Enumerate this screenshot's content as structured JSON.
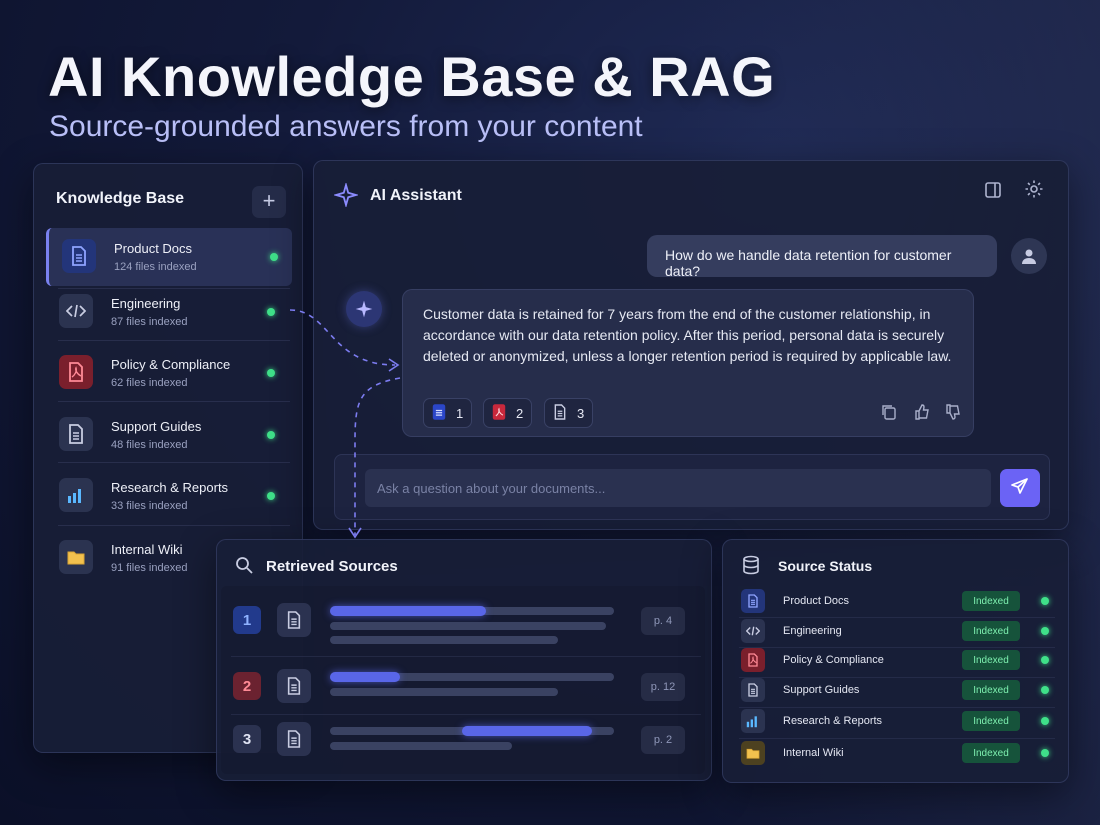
{
  "hero": {
    "title": "AI Knowledge Base & RAG",
    "subtitle": "Source-grounded answers from your content"
  },
  "knowledge_base": {
    "title": "Knowledge Base",
    "add_label": "+",
    "items": [
      {
        "name": "Product Docs",
        "count": "124 files indexed",
        "icon": "document-icon"
      },
      {
        "name": "Engineering",
        "count": "87 files indexed",
        "icon": "code-icon"
      },
      {
        "name": "Policy & Compliance",
        "count": "62 files indexed",
        "icon": "pdf-icon"
      },
      {
        "name": "Support Guides",
        "count": "48 files indexed",
        "icon": "document-icon"
      },
      {
        "name": "Research & Reports",
        "count": "33 files indexed",
        "icon": "bar-chart-icon"
      },
      {
        "name": "Internal Wiki",
        "count": "91 files indexed",
        "icon": "folder-icon"
      }
    ]
  },
  "assistant": {
    "title": "AI Assistant",
    "user_message": "How do we handle data retention for customer data?",
    "ai_message": "Customer data is retained for 7 years from the end of the customer relationship, in accordance with our data retention policy. After this period, personal data is securely deleted or anonymized, unless a longer retention period is required by applicable law.",
    "citations": [
      {
        "number": "1",
        "icon": "document-icon"
      },
      {
        "number": "2",
        "icon": "pdf-icon"
      },
      {
        "number": "3",
        "icon": "document-icon"
      }
    ],
    "composer_placeholder": "Ask a question about your documents..."
  },
  "retrieved_sources": {
    "title": "Retrieved Sources",
    "items": [
      {
        "number": "1",
        "page": "p. 4"
      },
      {
        "number": "2",
        "page": "p. 12"
      },
      {
        "number": "3",
        "page": "p. 2"
      }
    ]
  },
  "source_status": {
    "title": "Source Status",
    "items": [
      {
        "name": "Product Docs",
        "status": "Indexed",
        "icon": "document-icon"
      },
      {
        "name": "Engineering",
        "status": "Indexed",
        "icon": "code-icon"
      },
      {
        "name": "Policy & Compliance",
        "status": "Indexed",
        "icon": "pdf-icon"
      },
      {
        "name": "Support Guides",
        "status": "Indexed",
        "icon": "document-icon"
      },
      {
        "name": "Research & Reports",
        "status": "Indexed",
        "icon": "bar-chart-icon"
      },
      {
        "name": "Internal Wiki",
        "status": "Indexed",
        "icon": "folder-icon"
      }
    ]
  },
  "colors": {
    "accent": "#6b63f5",
    "status_green": "#3fe089",
    "badge_bg": "#16533b"
  }
}
